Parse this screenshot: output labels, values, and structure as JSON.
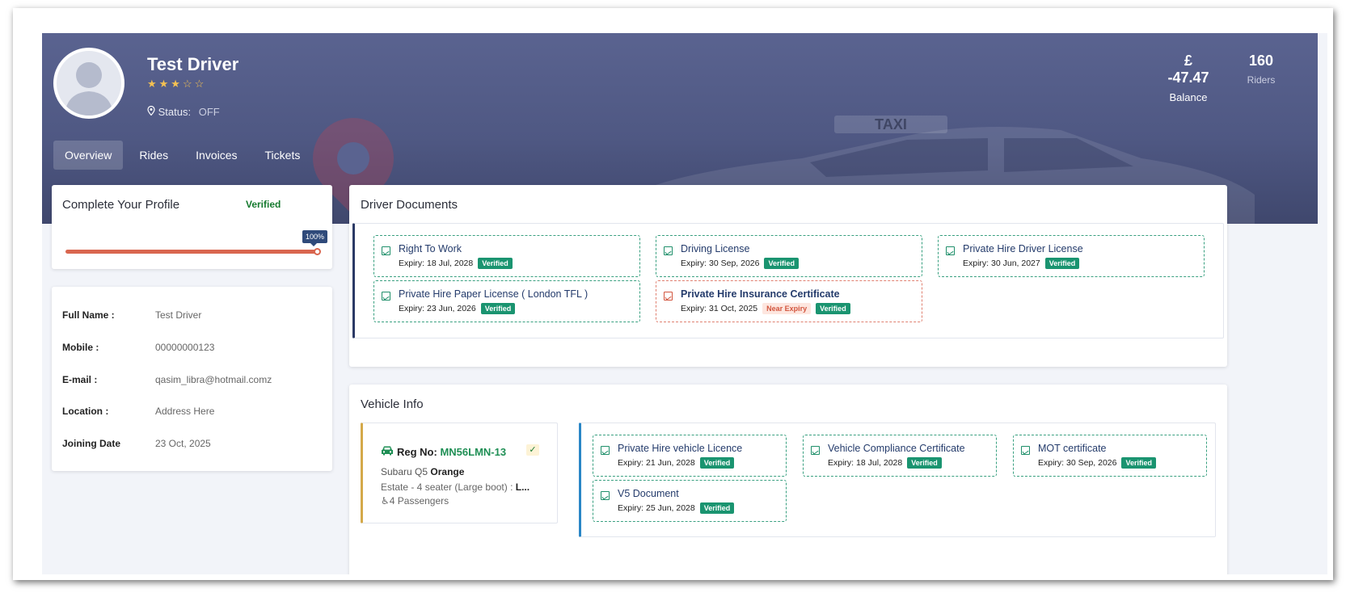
{
  "profile": {
    "name": "Test Driver",
    "rating": 3,
    "rating_max": 5,
    "stars_text": "★★★☆☆",
    "status_label": "Status:",
    "status_value": "OFF"
  },
  "stats": {
    "balance_currency": "£",
    "balance_value": "-47.47",
    "balance_label": "Balance",
    "riders_value": "160",
    "riders_label": "Riders"
  },
  "tabs": [
    {
      "label": "Overview",
      "active": true
    },
    {
      "label": "Rides",
      "active": false
    },
    {
      "label": "Invoices",
      "active": false
    },
    {
      "label": "Tickets",
      "active": false
    }
  ],
  "complete_profile": {
    "title": "Complete Your Profile",
    "status": "Verified",
    "progress_percent": 100,
    "progress_label": "100%"
  },
  "details": [
    {
      "key": "Full Name :",
      "value": "Test Driver"
    },
    {
      "key": "Mobile :",
      "value": "00000000123"
    },
    {
      "key": "E-mail :",
      "value": "qasim_libra@hotmail.comz"
    },
    {
      "key": "Location :",
      "value": "Address Here"
    },
    {
      "key": "Joining Date",
      "value": "23 Oct, 2025"
    }
  ],
  "driver_documents": {
    "title": "Driver Documents",
    "items": [
      {
        "name": "Right To Work",
        "expiry": "Expiry: 18 Jul, 2028",
        "badge": "Verified",
        "warning": ""
      },
      {
        "name": "Driving License",
        "expiry": "Expiry: 30 Sep, 2026",
        "badge": "Verified",
        "warning": ""
      },
      {
        "name": "Private Hire Driver License",
        "expiry": "Expiry: 30 Jun, 2027",
        "badge": "Verified",
        "warning": ""
      },
      {
        "name": "Private Hire Paper License ( London TFL )",
        "expiry": "Expiry: 23 Jun, 2026",
        "badge": "Verified",
        "warning": ""
      },
      {
        "name": "Private Hire Insurance Certificate",
        "expiry": "Expiry: 31 Oct, 2025",
        "badge": "Verified",
        "warning": "Near Expiry"
      }
    ]
  },
  "vehicle": {
    "title": "Vehicle Info",
    "reg_label": "Reg No:",
    "reg_value": "MN56LMN-13",
    "check_icon": "✓",
    "model": "Subaru Q5",
    "color": "Orange",
    "type_text": "Estate - 4 seater (Large boot) :",
    "type_bold": "L...",
    "passengers": "4 Passengers",
    "documents": [
      {
        "name": "Private Hire vehicle Licence",
        "expiry": "Expiry: 21 Jun, 2028",
        "badge": "Verified"
      },
      {
        "name": "Vehicle Compliance Certificate",
        "expiry": "Expiry: 18 Jul, 2028",
        "badge": "Verified"
      },
      {
        "name": "MOT certificate",
        "expiry": "Expiry: 30 Sep, 2026",
        "badge": "Verified"
      },
      {
        "name": "V5 Document",
        "expiry": "Expiry: 25 Jun, 2028",
        "badge": "Verified"
      }
    ]
  },
  "colors": {
    "header": "#4f5883",
    "verified_green": "#1a9470",
    "progress": "#d9664f",
    "near_expiry": "#d2553e"
  },
  "icons": {
    "location": "location-pin-icon",
    "document": "image-file-icon",
    "car": "car-icon",
    "passenger": "accessible-icon"
  }
}
